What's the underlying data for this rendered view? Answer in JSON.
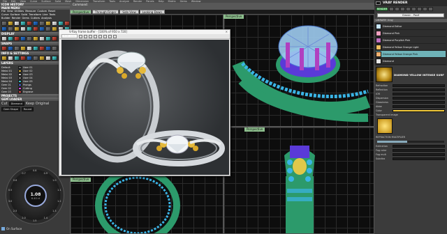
{
  "topbar": {
    "items": [
      "File",
      "Edit",
      "View",
      "Curve",
      "Surface",
      "Solid",
      "Mesh",
      "Dimension",
      "Transform",
      "Tools",
      "Analyze",
      "Render",
      "Panels",
      "Help",
      "Matrix",
      "Gems",
      "Window"
    ]
  },
  "left": {
    "main_history_label": "ICON HISTORY",
    "main_menu_label": "MAIN MENU",
    "menu_rows": [
      [
        "File",
        "View",
        "Utilities",
        "Measure",
        "Custom",
        "Reset"
      ],
      [
        "Curve",
        "Surface",
        "Solid",
        "Transform",
        "Line",
        "Tools"
      ],
      [
        "Builder",
        "Render",
        "Gems",
        "Cutters",
        "Analysis"
      ]
    ],
    "display_label": "DISPLAY",
    "snaps_label": "SNAPS",
    "info_label": "INFO & SETTINGS",
    "layers_label": "LAYERS",
    "layers": [
      {
        "name": "Default",
        "color": "#6a6a6a",
        "user": "User 01"
      },
      {
        "name": "Metal 01",
        "color": "#d9b13a",
        "user": "User 02"
      },
      {
        "name": "Metal 02",
        "color": "#b8b8b8",
        "user": "User 03"
      },
      {
        "name": "Metal 03",
        "color": "#8a8a8a",
        "user": "User 04"
      },
      {
        "name": "Metal 04",
        "color": "#3ec0c0",
        "user": "User 05"
      },
      {
        "name": "Gem 01",
        "color": "#4a6ad8",
        "user": "Prongs"
      },
      {
        "name": "Gem 02",
        "color": "#d44ad8",
        "user": "Cutting"
      },
      {
        "name": "Gem 03",
        "color": "#d84a4a",
        "user": "Engrave"
      }
    ],
    "projects_label": "PROJECTS",
    "gem_loader_label": "GEM LOADER",
    "cut_label": "Cut",
    "cut_value": "Diamond",
    "keep_label": "Keep Original",
    "gem_shape_label": "Gem Shape",
    "gem_shape_value": "Round",
    "dial_value": "1.08",
    "dial_sub": "6.40 ct",
    "dial_ticks": [
      "0.8",
      "0.9",
      "1.0",
      "1.1",
      "1.2",
      "1.3",
      "1.4",
      "1.5",
      "2.0",
      "2.5",
      "3.0",
      "0.5",
      "0.6",
      "0.7"
    ],
    "on_surface_label": "On Surface"
  },
  "viewports": {
    "command_label": "Command:",
    "tabs": [
      "Perspective",
      "Through Finger",
      "Side View",
      "Looking Down"
    ],
    "active_tab": "Perspective",
    "labels": [
      "Perspective",
      "Perspective",
      "Perspective"
    ]
  },
  "render_window": {
    "title": "V-Ray frame buffer - [100% of 950 x 720]",
    "channel": "RGB color",
    "tool_count": 8
  },
  "right": {
    "title": "VRAY RENDER",
    "render_button": "RENDER",
    "material_combo": "Classic - Pavé",
    "library_label": "LIBRARY: Vray",
    "materials": [
      {
        "name": "Diamond Editor",
        "color": "#c8e6ff"
      },
      {
        "name": "Diamond Pink",
        "color": "#f0a0c0"
      },
      {
        "name": "Diamond Purplish Pink",
        "color": "#c070c0"
      },
      {
        "name": "Diamond Yellow Orange Light",
        "color": "#f0c060"
      },
      {
        "name": "Diamond Yellow Orange Pink",
        "color": "#f0b070"
      },
      {
        "name": "Diamond",
        "color": "#e8e8e8"
      }
    ],
    "selected_material": "Diamond Yellow Orange Pink",
    "preview_title": "DIAMOND YELLOW INTENSE SURF",
    "props": [
      "Refraction",
      "Reflection",
      "IOR",
      "Dispersion",
      "Glossiness",
      "Abbe"
    ],
    "color_label": "Color",
    "transparent_label": "Transparent Image",
    "refraction_label": "REFRACTION MULTIPLIER",
    "refraction_value": 0.45,
    "props2": [
      "Extinction",
      "Fog color",
      "Fog mult",
      "Subdivs"
    ]
  }
}
